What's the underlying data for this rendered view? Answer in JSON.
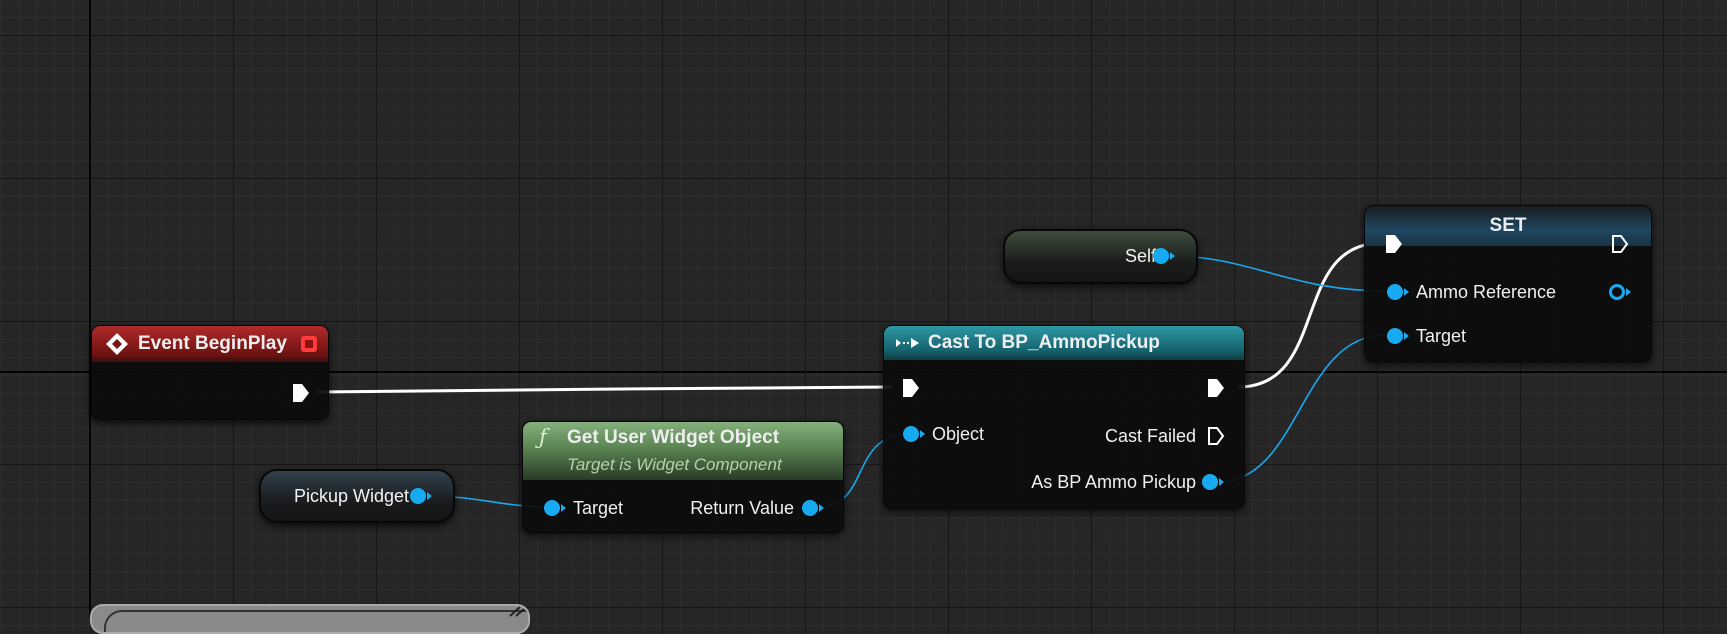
{
  "nodes": {
    "event_begin_play": {
      "title": "Event BeginPlay"
    },
    "self_var": {
      "label": "Self"
    },
    "pickup_widget_var": {
      "label": "Pickup Widget"
    },
    "get_user_widget": {
      "title": "Get User Widget Object",
      "subtitle": "Target is Widget Component",
      "function_glyph": "ƒ",
      "input_target": "Target",
      "output_return": "Return Value"
    },
    "cast_node": {
      "title": "Cast To BP_AmmoPickup",
      "input_object": "Object",
      "output_cast_failed": "Cast Failed",
      "output_as": "As BP Ammo Pickup"
    },
    "set_node": {
      "title": "SET",
      "input_ammo_reference": "Ammo Reference",
      "input_target": "Target"
    }
  },
  "colors": {
    "canvas_bg": "#262626",
    "event_header": "#8c1a1a",
    "cast_header": "#1f7a86",
    "function_header": "#6e9a68",
    "object_pin": "#18aaf0",
    "exec_wire": "#ffffff"
  },
  "icons": {
    "event_icon": "event-diamond-icon",
    "delegate_icon": "delegate-square-icon",
    "cast_icon": "cast-arrows-icon",
    "function_icon": "function-f-icon"
  }
}
